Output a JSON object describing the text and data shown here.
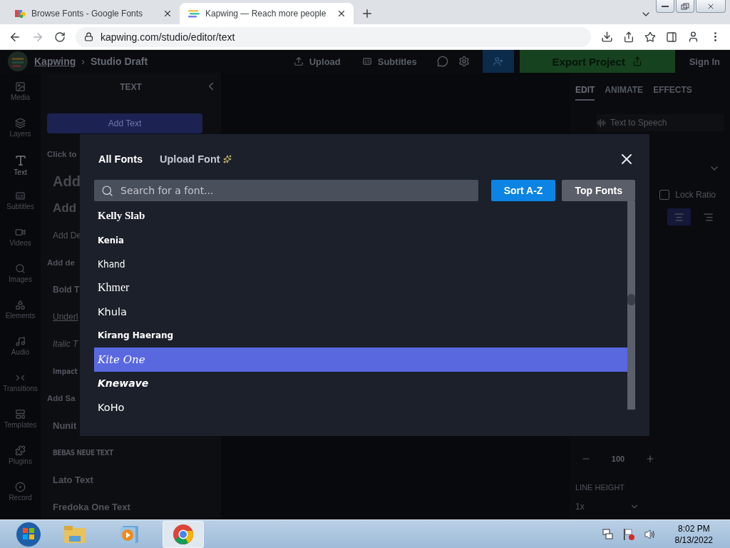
{
  "browser": {
    "tabs": [
      {
        "title": "Browse Fonts - Google Fonts",
        "selected": false
      },
      {
        "title": "Kapwing — Reach more people",
        "selected": true
      }
    ],
    "url": "kapwing.com/studio/editor/text"
  },
  "app": {
    "brand": "Kapwing",
    "separator": "›",
    "project": "Studio Draft",
    "actions": [
      "Upload",
      "Subtitles"
    ],
    "export": "Export Project",
    "sign_in": "Sign In"
  },
  "rail": [
    {
      "label": "Media",
      "kind": "media",
      "selected": false
    },
    {
      "label": "Layers",
      "kind": "layers",
      "selected": false
    },
    {
      "label": "Text",
      "kind": "text",
      "selected": true
    },
    {
      "label": "Subtitles",
      "kind": "subtitles",
      "selected": false
    },
    {
      "label": "Videos",
      "kind": "videos",
      "selected": false
    },
    {
      "label": "Images",
      "kind": "images",
      "selected": false
    },
    {
      "label": "Elements",
      "kind": "elements",
      "selected": false
    },
    {
      "label": "Audio",
      "kind": "audio",
      "selected": false
    },
    {
      "label": "Transitions",
      "kind": "transitions",
      "selected": false
    },
    {
      "label": "Templates",
      "kind": "templates",
      "selected": false
    },
    {
      "label": "Plugins",
      "kind": "plugins",
      "selected": false
    },
    {
      "label": "Record",
      "kind": "record",
      "selected": false
    }
  ],
  "text_panel": {
    "title": "TEXT",
    "add_button": "Add Text",
    "items": [
      {
        "label": "Click to",
        "kind": "section"
      },
      {
        "label": "Add",
        "kind": "heading"
      },
      {
        "label": "Add",
        "kind": "subheading"
      },
      {
        "label": "Add De",
        "kind": "body"
      },
      {
        "label": "Add de",
        "kind": "section"
      },
      {
        "label": "Bold T",
        "kind": "bold"
      },
      {
        "label": "Underl",
        "kind": "underline"
      },
      {
        "label": "Italic T",
        "kind": "italic"
      },
      {
        "label": "Impact",
        "kind": "impact"
      },
      {
        "label": "Add Sa",
        "kind": "section"
      },
      {
        "label": "Nunit",
        "kind": "sample"
      },
      {
        "label": "BEBAS NEUE TEXT",
        "kind": "condensed"
      },
      {
        "label": "Lato Text",
        "kind": "sample"
      },
      {
        "label": "Fredoka One Text",
        "kind": "rounded"
      }
    ]
  },
  "properties": {
    "tabs": [
      {
        "label": "EDIT",
        "selected": true
      },
      {
        "label": "ANIMATE",
        "selected": false
      },
      {
        "label": "EFFECTS",
        "selected": false
      }
    ],
    "tts": "Text to Speech",
    "lock_ratio": "Lock Ratio",
    "lock_ratio_checked": false,
    "size": "100",
    "line_height_label": "LINE HEIGHT",
    "line_height": "1x"
  },
  "font_dialog": {
    "tabs": [
      {
        "label": "All Fonts",
        "selected": true
      },
      {
        "label": "Upload Font",
        "selected": false
      }
    ],
    "search": {
      "placeholder": "Search for a font..."
    },
    "sort_buttons": [
      {
        "label": "Sort A-Z",
        "selected": true
      },
      {
        "label": "Top Fonts",
        "selected": false
      }
    ],
    "fonts": [
      {
        "name": "Kelly Slab",
        "kind": "slab",
        "selected": false
      },
      {
        "name": "Kenia",
        "kind": "heavy",
        "selected": false
      },
      {
        "name": "Khand",
        "kind": "condensed",
        "selected": false
      },
      {
        "name": "Khmer",
        "kind": "serif",
        "selected": false
      },
      {
        "name": "Khula",
        "kind": "sans",
        "selected": false
      },
      {
        "name": "Kirang Haerang",
        "kind": "brush",
        "selected": false
      },
      {
        "name": "Kite One",
        "kind": "italic",
        "selected": true
      },
      {
        "name": "Knewave",
        "kind": "script",
        "selected": false
      },
      {
        "name": "KoHo",
        "kind": "sans",
        "selected": false
      }
    ]
  },
  "taskbar": {
    "apps": [
      {
        "kind": "explorer",
        "selected": false
      },
      {
        "kind": "media",
        "selected": false
      },
      {
        "kind": "chrome",
        "selected": true
      }
    ],
    "time": "8:02 PM",
    "date": "8/13/2022"
  }
}
